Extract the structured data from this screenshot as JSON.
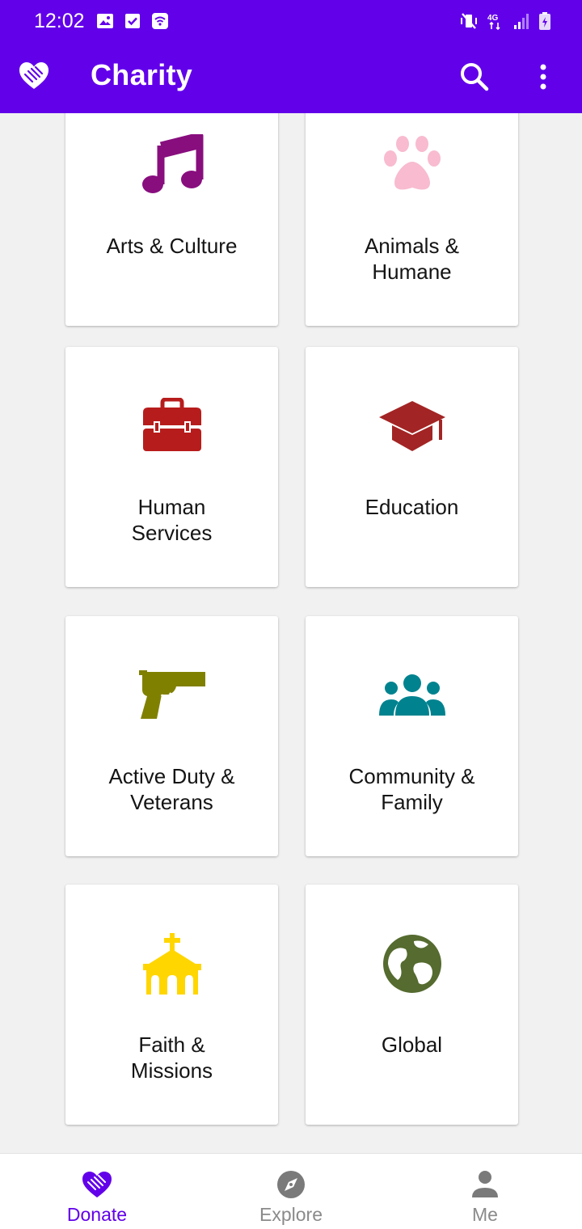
{
  "status_bar": {
    "time": "12:02"
  },
  "app_bar": {
    "title": "Charity"
  },
  "categories": [
    {
      "label": "Arts & Culture",
      "icon": "music-note-icon",
      "color": "#880e7e"
    },
    {
      "label": "Animals &\nHumane",
      "icon": "paw-icon",
      "color": "#f8bbd0"
    },
    {
      "label": "Human\nServices",
      "icon": "toolbox-icon",
      "color": "#b71c1c"
    },
    {
      "label": "Education",
      "icon": "graduation-cap-icon",
      "color": "#a32424"
    },
    {
      "label": "Active Duty &\nVeterans",
      "icon": "pistol-icon",
      "color": "#808000"
    },
    {
      "label": "Community &\nFamily",
      "icon": "people-group-icon",
      "color": "#00838f"
    },
    {
      "label": "Faith &\nMissions",
      "icon": "church-icon",
      "color": "#ffd600"
    },
    {
      "label": "Global",
      "icon": "globe-icon",
      "color": "#556b2f"
    }
  ],
  "bottom_nav": {
    "donate": "Donate",
    "explore": "Explore",
    "me": "Me"
  },
  "colors": {
    "primary": "#6200ea",
    "inactive": "#8a8a8a"
  }
}
